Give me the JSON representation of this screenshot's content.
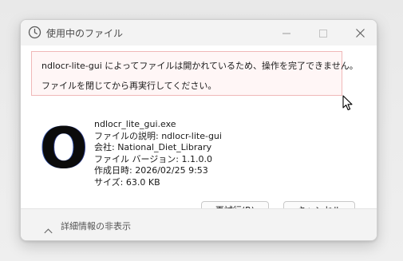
{
  "window": {
    "title": "使用中のファイル",
    "icon": "clock-icon"
  },
  "titlebar_controls": [
    "minimize-icon",
    "maximize-icon",
    "close-icon"
  ],
  "message": {
    "line1": "ndlocr-lite-gui によってファイルは開かれているため、操作を完了できません。",
    "line2": "ファイルを閉じてから再実行してください。"
  },
  "file": {
    "logo_letter": "O",
    "name": "ndlocr_lite_gui.exe",
    "description": "ファイルの説明: ndlocr-lite-gui",
    "company": "会社: National_Diet_Library",
    "version": "ファイル バージョン: 1.1.0.0",
    "created": "作成日時: 2026/02/25 9:53",
    "size": "サイズ: 63.0 KB"
  },
  "buttons": {
    "retry": "再試行(R)",
    "cancel": "キャンセル"
  },
  "footer": {
    "toggle_label": "詳細情報の非表示",
    "icon": "chevron-up-icon"
  },
  "colors": {
    "message_border": "#f0b8b8",
    "titlebar_bg": "#f3f3f3",
    "dialog_bg": "#ffffff"
  }
}
